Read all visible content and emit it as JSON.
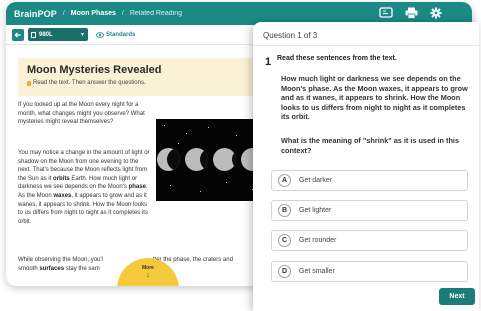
{
  "header": {
    "brand": "BrainPOP",
    "breadcrumb_topic": "Moon Phases",
    "breadcrumb_section": "Related Reading"
  },
  "toolbar": {
    "level": "980L",
    "standards_label": "Standards"
  },
  "article": {
    "title": "Moon Mysteries Revealed",
    "instructions": "Read the text. Then answer the questions.",
    "para1": "If you looked up at the Moon every night for a month, what changes might you observe? What mysteries might reveal themselves?",
    "para2_a": "You may notice a change in the amount of light or shadow on the Moon from one evening to the next. That's because the Moon reflects light from the Sun as it ",
    "para2_b": "orbits",
    "para2_c": " Earth. How much light or darkness we see depends on the Moon's ",
    "para2_d": "phase",
    "para2_e": ". As the Moon ",
    "para2_f": "waxes",
    "para2_g": ", it appears to grow and as it wanes, it appears to shrink. How the Moon looks to us differs from night to night as it completes its orbit.",
    "para3_a": "While observing the Moon, you'l",
    "para3_b": "tter the phase, the craters and",
    "para3_c": "smooth ",
    "para3_d": "surfaces",
    "para3_e": " stay the sam",
    "more_label": "More",
    "more_arrow": "↓"
  },
  "quiz": {
    "progress": "Question 1 of 3",
    "number": "1",
    "instruction": "Read these sentences from the text.",
    "passage": "How much light or darkness we see depends on the Moon's phase. As the Moon waxes, it appears to grow and as it wanes, it appears to shrink. How the Moon looks to us differs from night to night as it completes its orbit.",
    "question": "What is the meaning of \"shrink\" as it is used in this context?",
    "options": [
      {
        "letter": "A",
        "text": "Get darker"
      },
      {
        "letter": "B",
        "text": "Get lighter"
      },
      {
        "letter": "C",
        "text": "Get rounder"
      },
      {
        "letter": "D",
        "text": "Get smaller"
      }
    ],
    "next_label": "Next"
  },
  "colors": {
    "brand_teal": "#1b8a85",
    "banner": "#fbf1d4",
    "more_yellow": "#f6c83b"
  },
  "icons": [
    "captions-icon",
    "print-icon",
    "settings-icon",
    "back-arrow-icon",
    "document-icon",
    "eye-icon",
    "lightbulb-icon"
  ]
}
